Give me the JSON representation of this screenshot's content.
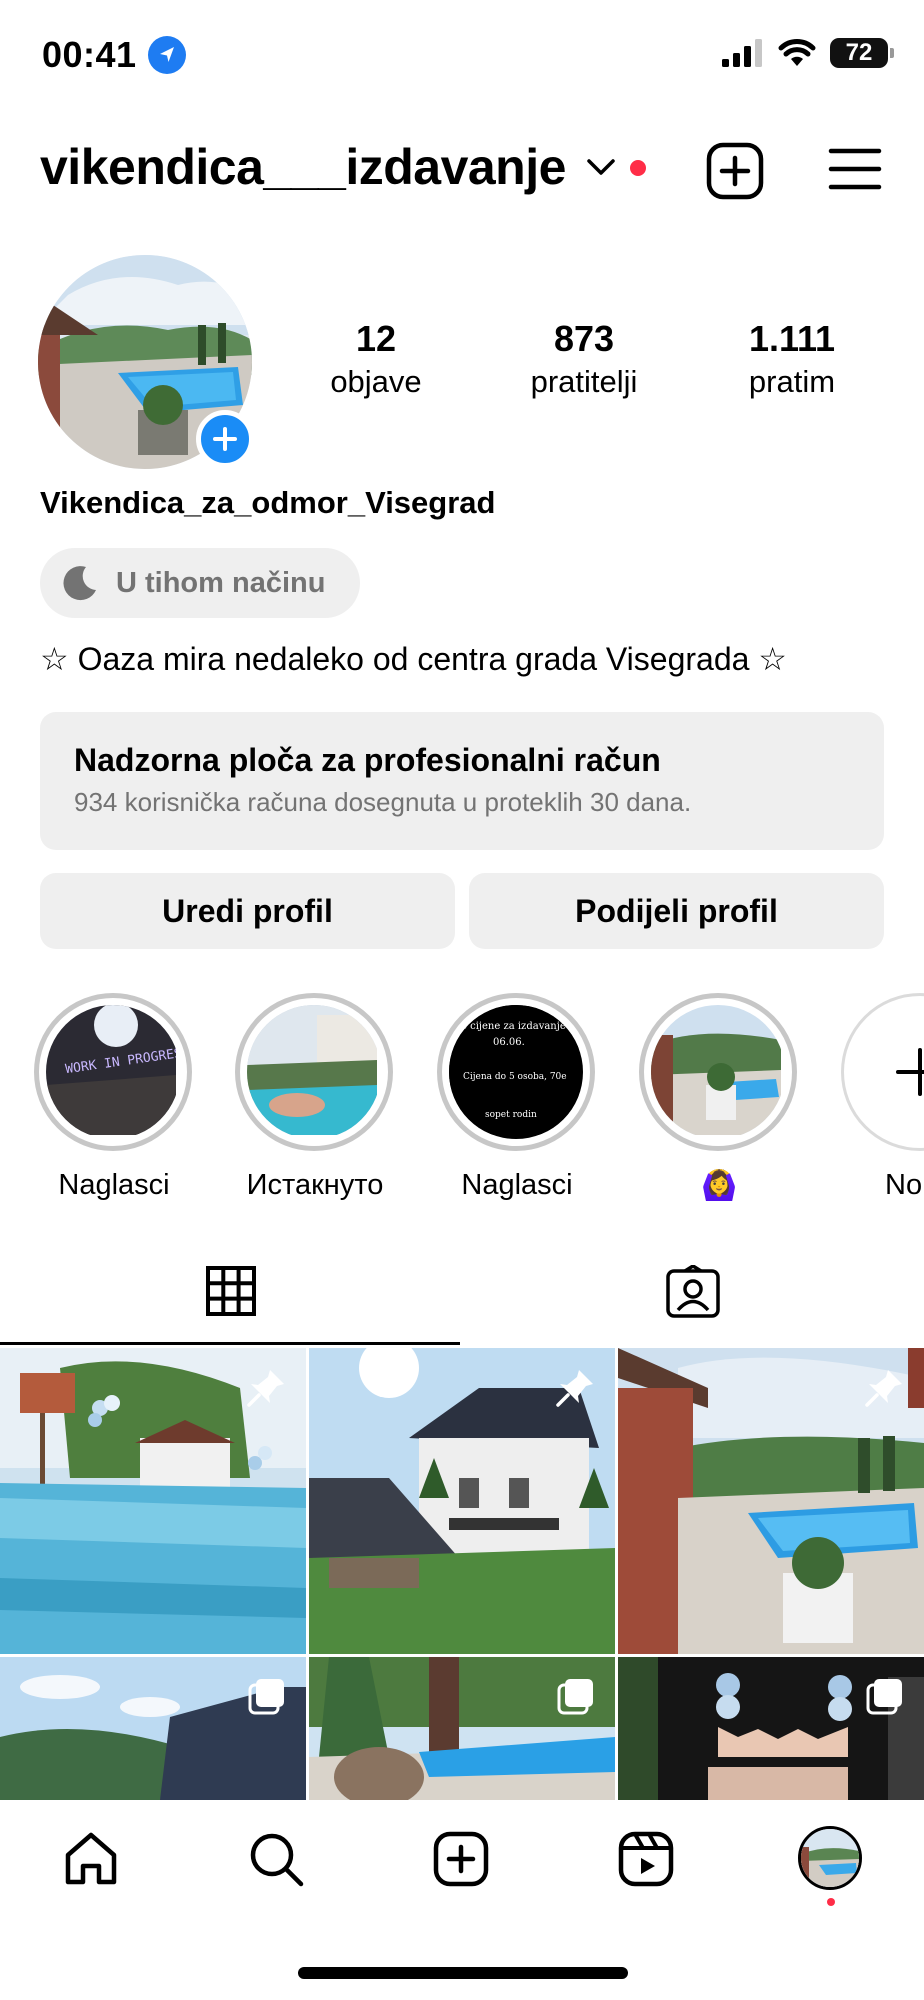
{
  "status_bar": {
    "time": "00:41",
    "battery": "72"
  },
  "header": {
    "username": "vikendica___izdavanje"
  },
  "profile": {
    "stats": [
      {
        "value": "12",
        "label": "objave"
      },
      {
        "value": "873",
        "label": "pratitelji"
      },
      {
        "value": "1.111",
        "label": "pratim"
      }
    ],
    "display_name": "Vikendica_za_odmor_Visegrad",
    "quiet_mode": "U tihom načinu",
    "bio": "☆ Oaza mira nedaleko od centra grada Visegrada ☆"
  },
  "dashboard": {
    "title": "Nadzorna ploča za profesionalni račun",
    "subtitle": "934 korisnička računa dosegnuta u proteklih 30 dana."
  },
  "buttons": {
    "edit": "Uredi profil",
    "share": "Podijeli profil"
  },
  "highlights": [
    {
      "label": "Naglasci",
      "cover_text": "WORK IN PROGRESS"
    },
    {
      "label": "Истакнуто"
    },
    {
      "label": "Naglasci",
      "cover_lines": [
        "e cijene za izdavanje",
        "06.06.",
        "Cijena do 5 osoba, 70e",
        "sopet rodin"
      ]
    },
    {
      "label": "🙆‍♀️"
    },
    {
      "label": "No"
    }
  ],
  "colors": {
    "accent_blue": "#1a8cf6",
    "notification_red": "#ff2d47",
    "pill_gray": "#efefef",
    "secondary_text": "#737373"
  },
  "icons": [
    "location-arrow-icon",
    "chevron-down-icon",
    "plus-square-icon",
    "menu-icon",
    "grid-icon",
    "tagged-icon",
    "home-icon",
    "search-icon",
    "create-icon",
    "reels-icon",
    "pin-icon",
    "carousel-icon"
  ]
}
